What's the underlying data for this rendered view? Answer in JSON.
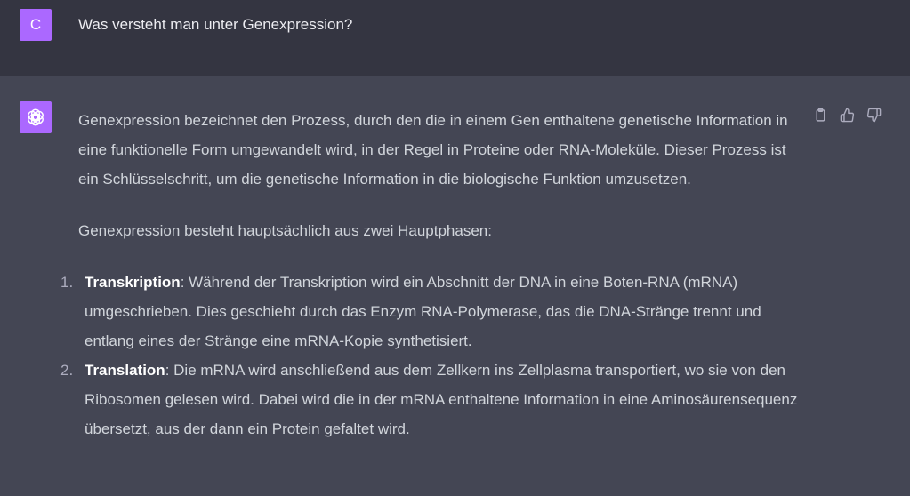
{
  "user": {
    "avatar_letter": "C",
    "message": "Was versteht man unter Genexpression?"
  },
  "assistant": {
    "paragraph1": "Genexpression bezeichnet den Prozess, durch den die in einem Gen enthaltene genetische Information in eine funktionelle Form umgewandelt wird, in der Regel in Proteine oder RNA-Moleküle. Dieser Prozess ist ein Schlüsselschritt, um die genetische Information in die biologische Funktion umzusetzen.",
    "paragraph2": "Genexpression besteht hauptsächlich aus zwei Hauptphasen:",
    "list": [
      {
        "num": "1.",
        "term": "Transkription",
        "text": ": Während der Transkription wird ein Abschnitt der DNA in eine Boten-RNA (mRNA) umgeschrieben. Dies geschieht durch das Enzym RNA-Polymerase, das die DNA-Stränge trennt und entlang eines der Stränge eine mRNA-Kopie synthetisiert."
      },
      {
        "num": "2.",
        "term": "Translation",
        "text": ": Die mRNA wird anschließend aus dem Zellkern ins Zellplasma transportiert, wo sie von den Ribosomen gelesen wird. Dabei wird die in der mRNA enthaltene Information in eine Aminosäurensequenz übersetzt, aus der dann ein Protein gefaltet wird."
      }
    ],
    "actions": {
      "copy_icon": "clipboard-icon",
      "like_icon": "thumbs-up-icon",
      "dislike_icon": "thumbs-down-icon"
    }
  },
  "colors": {
    "user_bg": "#343541",
    "assistant_bg": "#444654",
    "avatar": "#ab68ff"
  }
}
